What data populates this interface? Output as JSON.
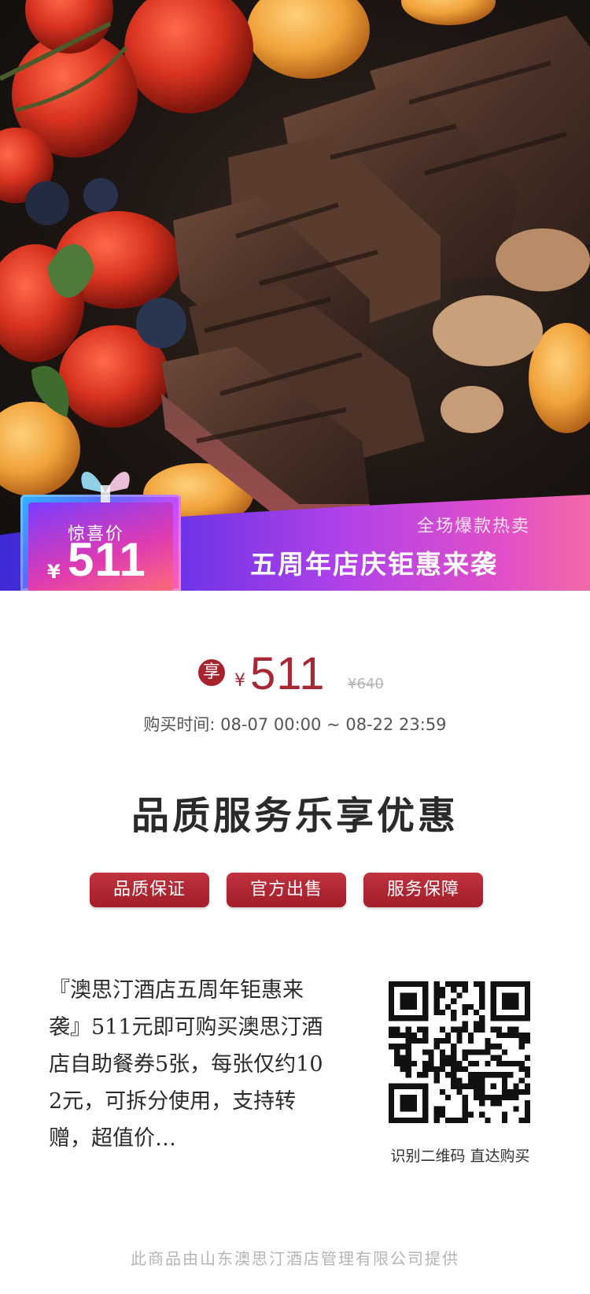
{
  "hero": {
    "surprise_label": "惊喜价",
    "badge_currency": "¥",
    "badge_price": "511",
    "banner_subtitle": "全场爆款热卖",
    "banner_title": "五周年店庆钜惠来袭"
  },
  "price": {
    "member_badge": "享",
    "currency": "¥",
    "current": "511",
    "original": "¥640",
    "purchase_time": "购买时间:  08-07 00:00 ~ 08-22 23:59"
  },
  "slogan": "品质服务乐享优惠",
  "tags": [
    "品质保证",
    "官方出售",
    "服务保障"
  ],
  "description": "『澳思汀酒店五周年钜惠来袭』511元即可购买澳思汀酒店自助餐券5张，每张仅约102元，可拆分使用，支持转赠，超值价…",
  "qr_caption": "识别二维码 直达购买",
  "footer": "此商品由山东澳思汀酒店管理有限公司提供",
  "colors": {
    "accent_red": "#a62834",
    "tag_red": "#b0262f",
    "banner_start": "#3e2ad6",
    "banner_end": "#f26aa8"
  }
}
